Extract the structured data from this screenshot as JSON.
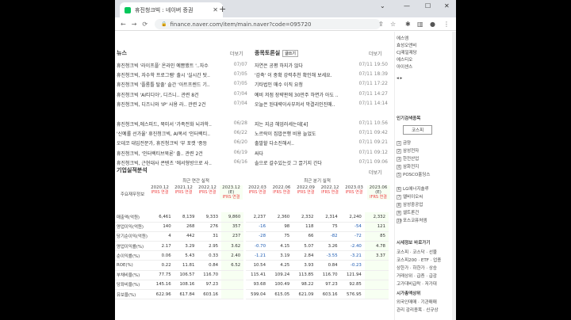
{
  "browser": {
    "tab_title": "휴진청크빅 : 네이버 증권",
    "url": "finance.naver.com/item/main.naver?code=095720"
  },
  "news": {
    "header": "뉴스",
    "more": "더보기",
    "items": [
      {
        "t": "휴진청크빅 '라이프플' 온라인 예쁨했트 '..자수",
        "d": "07/07"
      },
      {
        "t": "휴진청크빅, 자수학 프로그램' 출시 '실시간 탓..",
        "d": "07/05"
      },
      {
        "t": "휴진청크빅 '플롬틀 탈출' 솔간 '아트프렌드 기..",
        "d": "07/05"
      },
      {
        "t": "휴진청크빅 'AI티디아', 디즈니..  관련 8건",
        "d": "07/04"
      },
      {
        "t": "휴진청크빅, 디즈니와 'IP' 사용 라..  관련 2건",
        "d": "07/04"
      },
      {
        "t": "휴진청크빅,에스피드, 북미서 '가족전화 뇌과학..",
        "d": "06/28"
      },
      {
        "t": "'신예롤 선가율' 휴진청크빅, AI복서 '인터렉티..",
        "d": "06/22"
      },
      {
        "t": "오데코 대입전문가, 휴진청크빅 '부 포캣 '중등",
        "d": "06/20"
      },
      {
        "t": "휴진청크빅, '인터렉티브북론' 출..  관련 2건",
        "d": "06/19"
      },
      {
        "t": "휴진청크빅, 근현대사 콘텐츠 '에서형방으로 사..",
        "d": "06/16"
      }
    ]
  },
  "discussion": {
    "header": "종목토론실",
    "btn": "글쓰기",
    "more": "더보기",
    "items": [
      {
        "t": "자연은 공평 하지가 않다 ",
        "d": "07/11 19:50"
      },
      {
        "t": "'감축' 이 중확 강력추천 확인해 보세요. ",
        "d": "07/11 18:39"
      },
      {
        "t": "기타법인 매수 이직 요청 ",
        "d": "07/11 17:22"
      },
      {
        "t": "예비 저점 장략판에 30만주 하면가 아도 ..",
        "d": "07/11 14:27"
      },
      {
        "t": "오늘은 된대략이사부저서 막결리인진매..",
        "d": "07/11 14:14"
      },
      {
        "t": "지는 지금 헤업러세는데[4] ",
        "d": "07/11 10:56"
      },
      {
        "t": "노르락이 집밥은행 비용 늘었도 ",
        "d": "07/11 09:42"
      },
      {
        "t": "출발할 다소진해서.. ",
        "d": "07/11 09:21"
      },
      {
        "t": "싸다 ",
        "d": "07/11 09:12"
      },
      {
        "t": "솔으로 갈수있는것 그 끌기지 간다 ",
        "d": "07/11 09:06"
      }
    ]
  },
  "finance": {
    "header": "기업실적분석",
    "more": "더보기",
    "annual_label": "최근 연간 실적",
    "quarter_label": "최근 분기 실적",
    "row_head": "주요재무정보",
    "ifrs": "IFRS 연결",
    "years": [
      "2020.12",
      "2021.12",
      "2022.12",
      "2023.12 (E)"
    ],
    "quarters": [
      "2022.03",
      "2022.06",
      "2022.09",
      "2022.12",
      "2023.03",
      "2023.06 (E)"
    ],
    "rows": [
      {
        "l": "매출액(억원)",
        "a": [
          "6,461",
          "8,139",
          "9,333",
          "9,860"
        ],
        "q": [
          "2,237",
          "2,360",
          "2,332",
          "2,314",
          "2,240",
          "2,332"
        ]
      },
      {
        "l": "영업이익(억원)",
        "a": [
          "140",
          "268",
          "276",
          "357"
        ],
        "q": [
          "-16",
          "98",
          "118",
          "75",
          "-54",
          "121"
        ]
      },
      {
        "l": "당기순이익(억원)",
        "a": [
          "4",
          "442",
          "31",
          "237"
        ],
        "q": [
          "-28",
          "75",
          "66",
          "-82",
          "-72",
          "85"
        ]
      },
      {
        "l": "영업이익률(%)",
        "a": [
          "2.17",
          "3.29",
          "2.95",
          "3.62"
        ],
        "q": [
          "-0.70",
          "4.15",
          "5.07",
          "3.26",
          "-2.40",
          "4.78"
        ]
      },
      {
        "l": "순이익률(%)",
        "a": [
          "0.06",
          "5.43",
          "0.33",
          "2.40"
        ],
        "q": [
          "-1.21",
          "3.19",
          "2.84",
          "-3.55",
          "-3.21",
          "3.37"
        ]
      },
      {
        "l": "ROE(%)",
        "a": [
          "0.22",
          "11.81",
          "0.84",
          "6.52"
        ],
        "q": [
          "10.54",
          "4.25",
          "3.93",
          "0.84",
          "-0.23",
          ""
        ]
      },
      {
        "l": "부채비율(%)",
        "a": [
          "77.75",
          "106.57",
          "116.70",
          ""
        ],
        "q": [
          "115.41",
          "109.24",
          "113.85",
          "116.70",
          "121.94",
          ""
        ]
      },
      {
        "l": "당좌비율(%)",
        "a": [
          "145.16",
          "108.16",
          "97.23",
          ""
        ],
        "q": [
          "93.68",
          "100.49",
          "98.22",
          "97.23",
          "92.85",
          ""
        ]
      },
      {
        "l": "유보율(%)",
        "a": [
          "622.96",
          "617.84",
          "603.16",
          ""
        ],
        "q": [
          "599.04",
          "615.05",
          "621.09",
          "603.16",
          "576.95",
          ""
        ]
      }
    ]
  },
  "right": {
    "top": [
      "에스엠",
      "효성오앤비",
      "CJ제일제당",
      "에스티오",
      "아이센스"
    ],
    "popular_h": "인기검색종목",
    "kospi": "코스피",
    "ranks": [
      "금양",
      "삼성전자",
      "한전산업",
      "삼화전지",
      "POSCO홀딩스"
    ],
    "ranks2": [
      "LG에너지솔루",
      "엘비이오씨",
      "삼성중공업",
      "셀트론건",
      "포스코퓨처엠"
    ],
    "market_h": "시세정보 바로가기",
    "links": [
      "코스피 · 코스닥 · 선물",
      "코스피200 · ETF · 업종",
      "상한가 · 하한가 · 상승",
      "거래상위 · 급증 · 급감",
      "고가대비급락 · 저가대"
    ],
    "cap_h": "시가총액상위",
    "cap": [
      "외국인매매 · 기관매매",
      "관리 감리종목 · 신규상"
    ]
  }
}
